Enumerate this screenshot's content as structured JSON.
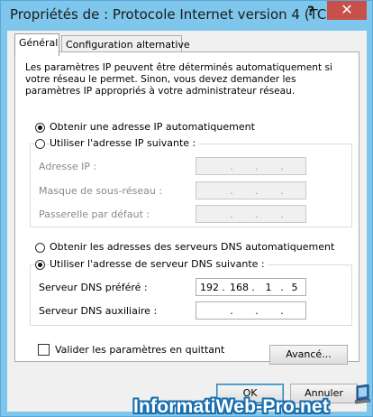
{
  "window": {
    "title": "Propriétés de : Protocole Internet version 4 (TC...",
    "help_symbol": "?",
    "close_symbol": "✕"
  },
  "tabs": [
    {
      "label": "Général",
      "active": true
    },
    {
      "label": "Configuration alternative",
      "active": false
    }
  ],
  "intro": "Les paramètres IP peuvent être déterminés automatiquement si votre réseau le permet. Sinon, vous devez demander les paramètres IP appropriés à votre administrateur réseau.",
  "ip_section": {
    "auto_label": "Obtenir une adresse IP automatiquement",
    "auto_checked": true,
    "manual_label": "Utiliser l'adresse IP suivante :",
    "manual_checked": false,
    "fields": [
      {
        "label": "Adresse IP :",
        "octets": [
          "",
          "",
          "",
          ""
        ]
      },
      {
        "label": "Masque de sous-réseau :",
        "octets": [
          "",
          "",
          "",
          ""
        ]
      },
      {
        "label": "Passerelle par défaut :",
        "octets": [
          "",
          "",
          "",
          ""
        ]
      }
    ]
  },
  "dns_section": {
    "auto_label": "Obtenir les adresses des serveurs DNS automatiquement",
    "auto_checked": false,
    "manual_label": "Utiliser l'adresse de serveur DNS suivante :",
    "manual_checked": true,
    "fields": [
      {
        "label": "Serveur DNS préféré :",
        "octets": [
          "192",
          "168",
          "1",
          "5"
        ]
      },
      {
        "label": "Serveur DNS auxiliaire :",
        "octets": [
          "",
          "",
          "",
          ""
        ]
      }
    ]
  },
  "validate_label": "Valider les paramètres en quittant",
  "validate_checked": false,
  "buttons": {
    "advanced": "Avancé...",
    "ok": "OK",
    "cancel": "Annuler"
  },
  "watermark": "InformatiWeb-Pro.net",
  "colors": {
    "title_bar": "#7ec6ec",
    "close_button": "#c7504a",
    "watermark_outline": "#1b6fae"
  }
}
